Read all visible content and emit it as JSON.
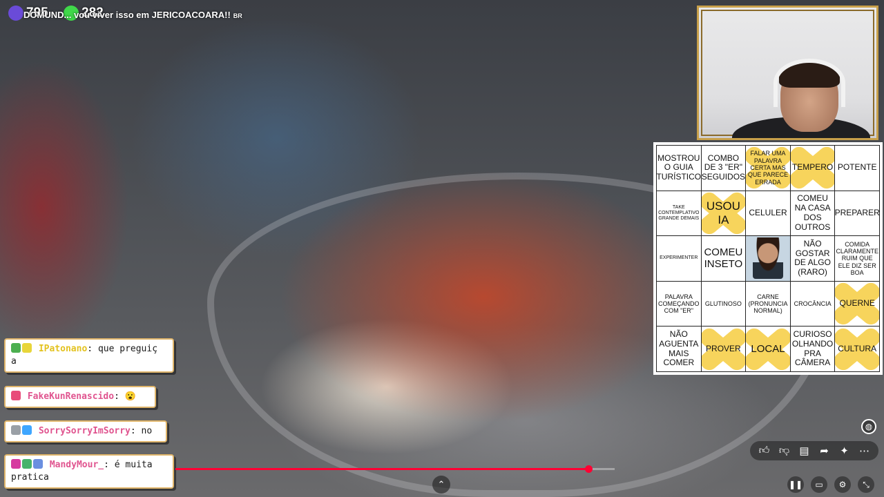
{
  "counters": [
    {
      "value": "795",
      "color": "#6a4bd8"
    },
    {
      "value": "282",
      "color": "#40d84a"
    }
  ],
  "ticker": {
    "text": "DOMUND... vou viver isso em JERICOACOARA!!",
    "tag": "BR"
  },
  "bingo": {
    "cells": [
      {
        "text": "MOSTROU O GUIA TURÍSTICO",
        "size": "m",
        "marked": false
      },
      {
        "text": "COMBO DE 3 \"ER\" SEGUIDOS",
        "size": "m",
        "marked": false
      },
      {
        "text": "FALAR UMA PALAVRA CERTA MAS QUE PARECE ERRADA",
        "size": "s",
        "marked": true
      },
      {
        "text": "TEMPERO",
        "size": "m",
        "marked": true
      },
      {
        "text": "POTENTE",
        "size": "m",
        "marked": false
      },
      {
        "text": "TAKE CONTEMPLATIVO GRANDE DEMAIS",
        "size": "xs",
        "marked": false
      },
      {
        "text": "USOU IA",
        "size": "xl",
        "marked": true
      },
      {
        "text": "CELULER",
        "size": "m",
        "marked": false
      },
      {
        "text": "COMEU NA CASA DOS OUTROS",
        "size": "m",
        "marked": false
      },
      {
        "text": "PREPARER",
        "size": "m",
        "marked": false
      },
      {
        "text": "EXPERIMENTER",
        "size": "xs",
        "marked": false
      },
      {
        "text": "COMEU INSETO",
        "size": "l",
        "marked": false
      },
      {
        "text": "",
        "size": "m",
        "marked": false,
        "photo": true
      },
      {
        "text": "NÃO GOSTAR DE ALGO (RARO)",
        "size": "m",
        "marked": false
      },
      {
        "text": "COMIDA CLARAMENTE RUIM QUE ELE DIZ SER BOA",
        "size": "s",
        "marked": false
      },
      {
        "text": "PALAVRA COMEÇANDO COM \"ER\"",
        "size": "s",
        "marked": false
      },
      {
        "text": "GLUTINOSO",
        "size": "s",
        "marked": false
      },
      {
        "text": "CARNE (PRONUNCIA NORMAL)",
        "size": "s",
        "marked": false
      },
      {
        "text": "CROCÂNCIA",
        "size": "s",
        "marked": false
      },
      {
        "text": "QUERNE",
        "size": "m",
        "marked": true
      },
      {
        "text": "NÃO AGUENTA MAIS COMER",
        "size": "m",
        "marked": false
      },
      {
        "text": "PROVER",
        "size": "m",
        "marked": true
      },
      {
        "text": "LOCAL",
        "size": "l",
        "marked": true
      },
      {
        "text": "CURIOSO OLHANDO PRA CÂMERA",
        "size": "m",
        "marked": false
      },
      {
        "text": "CULTURA",
        "size": "m",
        "marked": true
      }
    ]
  },
  "chat": [
    {
      "user": "IPatonano",
      "user_color": "#e3c21f",
      "message": "que preguiç a",
      "badges": [
        "#4caf50",
        "#e8d53a"
      ]
    },
    {
      "user": "FakeKunRenascido",
      "user_color": "#e0548f",
      "message": "😮",
      "badges": [
        "#e84c7a"
      ]
    },
    {
      "user": "SorrySorryImSorry",
      "user_color": "#e0548f",
      "message": "no",
      "badges": [
        "#9aa0a6",
        "#3ea6ff"
      ]
    },
    {
      "user": "MandyMour_",
      "user_color": "#e0548f",
      "message": "é muita pratica",
      "badges": [
        "#d63aa0",
        "#47b36b",
        "#6a8fe0"
      ]
    }
  ],
  "player": {
    "progress": 0.941
  },
  "icons": {
    "actions": [
      "like-icon",
      "dislike-icon",
      "comment-icon",
      "share-icon",
      "sparkle-icon",
      "more-icon"
    ],
    "globe": "globe-icon",
    "expand": "chevron-up-icon",
    "bottom": [
      "pause-icon",
      "captions-icon",
      "settings-icon",
      "collapse-icon"
    ]
  }
}
